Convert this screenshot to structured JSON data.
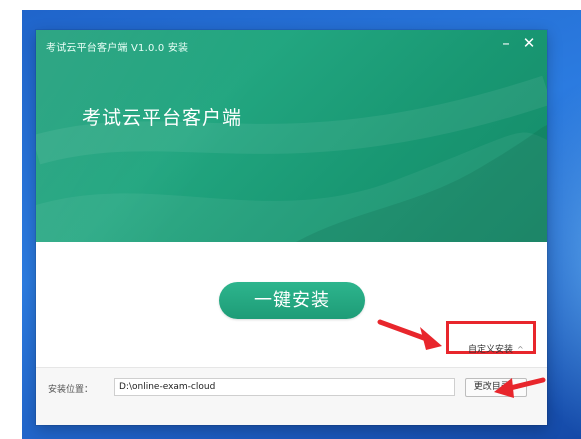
{
  "window": {
    "title": "考试云平台客户端 V1.0.0 安装",
    "minimize_glyph": "–",
    "close_glyph": "✕"
  },
  "hero": {
    "heading": "考试云平台客户端"
  },
  "actions": {
    "install_label": "一键安装",
    "custom_install_label": "自定义安装",
    "custom_install_caret": "^"
  },
  "install_path": {
    "label": "安装位置：",
    "value": "D:\\online-exam-cloud",
    "change_label": "更改目录..."
  },
  "colors": {
    "brand_green": "#1e9e7a",
    "highlight_red": "#e8262c",
    "desktop_blue": "#2b7be0"
  },
  "icons": {
    "minimize": "minimize-icon",
    "close": "close-icon",
    "annotation_arrow": "red-arrow-icon"
  }
}
